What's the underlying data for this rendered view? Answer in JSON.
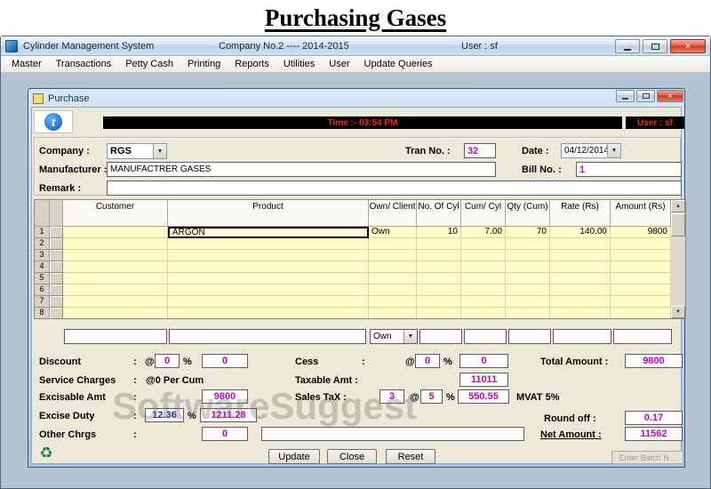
{
  "banner": {
    "title": "Purchasing Gases"
  },
  "app": {
    "title": "Cylinder Management System",
    "company": "Company No.2 ---- 2014-2015",
    "user": "User : sf",
    "menu": {
      "items": [
        "Master",
        "Transactions",
        "Petty Cash",
        "Printing",
        "Reports",
        "Utilities",
        "User",
        "Update Queries"
      ]
    }
  },
  "window": {
    "title": "Purchase",
    "time": "Time :-  03:54 PM",
    "user": "User : sf"
  },
  "symbols": {
    "colon": ":",
    "at": "@",
    "percent": "%"
  },
  "icons": {
    "close": "×",
    "dropdown": "▼",
    "up_arrow": "▲",
    "down_arrow": "▼",
    "recycle": "♻",
    "logo": "t"
  },
  "colors": {
    "value_text": "#c400c4",
    "excise_value_text": "#2222cc",
    "time_text": "#ff2222",
    "grid_row_bg": "#fcfcc6"
  },
  "form": {
    "company_label": "Company :",
    "company_value": "RGS",
    "tran_label": "Tran No. :",
    "tran_value": "32",
    "date_label": "Date :",
    "date_value": "04/12/2014",
    "manufacturer_label": "Manufacturer :",
    "manufacturer_value": "MANUFACTRER GASES",
    "bill_label": "Bill No. :",
    "bill_value": "1",
    "remark_label": "Remark :",
    "remark_value": ""
  },
  "grid": {
    "headers": [
      "Customer",
      "Product",
      "Own/ Client",
      "No. Of Cyl",
      "Cum/ Cyl",
      "Qty (Cum)",
      "Rate (Rs)",
      "Amount (Rs)"
    ],
    "rows": [
      {
        "num": "1",
        "customer": "",
        "product": "ARGON",
        "own": "Own",
        "cyl": "10",
        "cum": "7.00",
        "qty": "70",
        "rate": "140.00",
        "amount": "9800"
      },
      {
        "num": "2",
        "customer": "",
        "product": "",
        "own": "",
        "cyl": "",
        "cum": "",
        "qty": "",
        "rate": "",
        "amount": ""
      },
      {
        "num": "3",
        "customer": "",
        "product": "",
        "own": "",
        "cyl": "",
        "cum": "",
        "qty": "",
        "rate": "",
        "amount": ""
      },
      {
        "num": "4",
        "customer": "",
        "product": "",
        "own": "",
        "cyl": "",
        "cum": "",
        "qty": "",
        "rate": "",
        "amount": ""
      },
      {
        "num": "5",
        "customer": "",
        "product": "",
        "own": "",
        "cyl": "",
        "cum": "",
        "qty": "",
        "rate": "",
        "amount": ""
      },
      {
        "num": "6",
        "customer": "",
        "product": "",
        "own": "",
        "cyl": "",
        "cum": "",
        "qty": "",
        "rate": "",
        "amount": ""
      },
      {
        "num": "7",
        "customer": "",
        "product": "",
        "own": "",
        "cyl": "",
        "cum": "",
        "qty": "",
        "rate": "",
        "amount": ""
      },
      {
        "num": "8",
        "customer": "",
        "product": "",
        "own": "",
        "cyl": "",
        "cum": "",
        "qty": "",
        "rate": "",
        "amount": ""
      }
    ],
    "entry": {
      "customer": "",
      "product": "",
      "own_value": "Own",
      "cyl": "",
      "cum": "",
      "qty": "",
      "rate": "",
      "amount": ""
    }
  },
  "totals": {
    "discount_label": "Discount",
    "discount_pct": "0",
    "discount_value": "0",
    "service_label": "Service Charges",
    "service_text": "@0  Per Cum",
    "excisable_label": "Excisable Amt",
    "excisable_value": "9800",
    "excise_label": "Excise Duty",
    "excise_pct": "12.36",
    "excise_value": "1211.28",
    "other_label": "Other Chrgs",
    "other_value": "0",
    "other_extra": "",
    "cess_label": "Cess",
    "cess_pct": "0",
    "cess_value": "0",
    "taxable_label": "Taxable Amt :",
    "taxable_value": "11011",
    "salestax_label": "Sales TaX :",
    "salestax_qty": "3",
    "salestax_pct": "5",
    "salestax_value": "550.55",
    "mvat_label": "MVAT 5%",
    "total_label": "Total Amount :",
    "total_value": "9800",
    "round_label": "Round off :",
    "round_value": "0.17",
    "net_label": "Net Amount :",
    "net_value": "11562"
  },
  "buttons": {
    "update": "Update",
    "close": "Close",
    "reset": "Reset",
    "batch": "Enter Batch N..."
  },
  "watermark": "SoftwareSuggest"
}
